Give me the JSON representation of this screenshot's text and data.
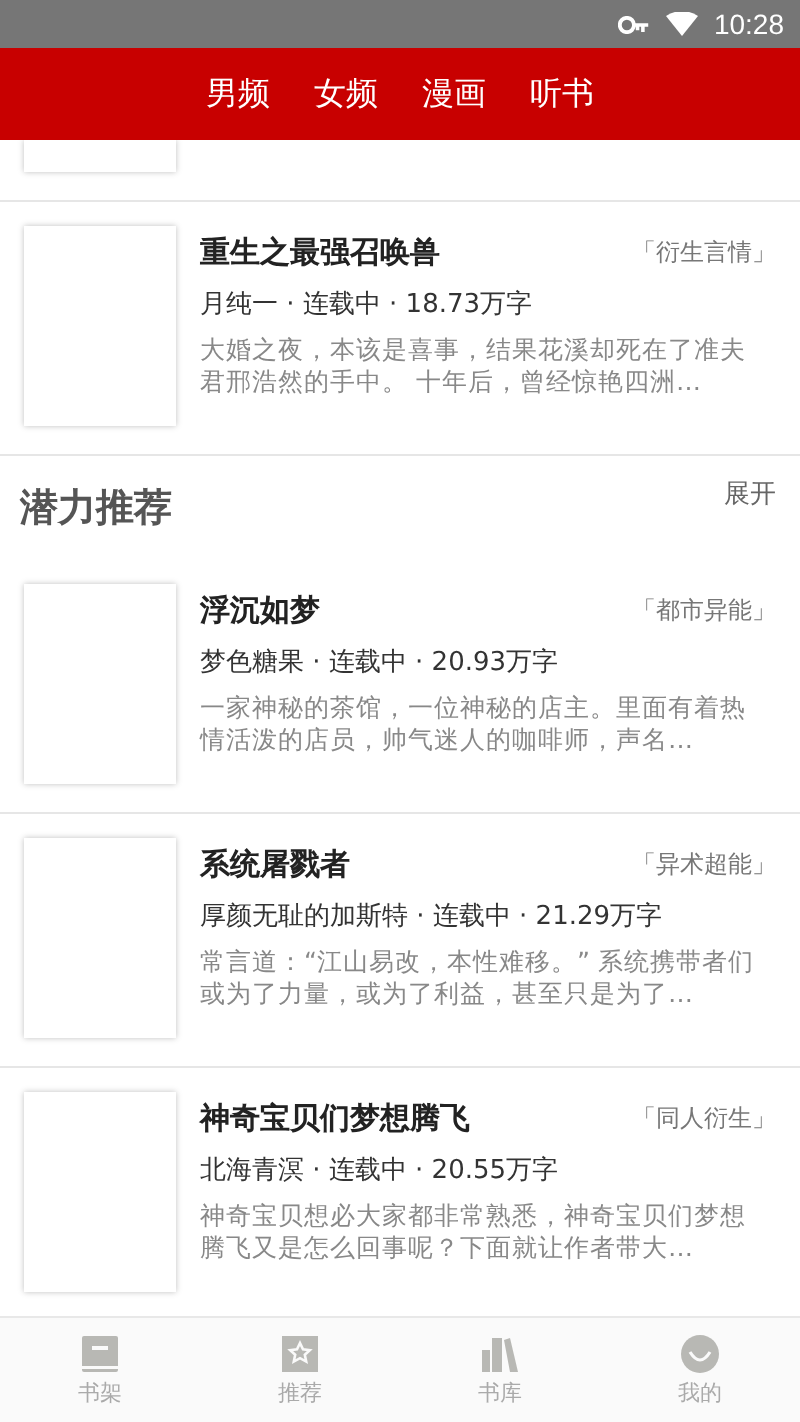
{
  "status_bar": {
    "time": "10:28"
  },
  "tabs": [
    {
      "label": "男频",
      "selected": false
    },
    {
      "label": "女频",
      "selected": false
    },
    {
      "label": "漫画",
      "selected": false
    },
    {
      "label": "听书",
      "selected": false
    }
  ],
  "top_books": [
    {
      "title": "重生之最强召唤兽",
      "tag": "「衍生言情」",
      "meta": "月纯一 · 连载中 · 18.73万字",
      "description": "大婚之夜，本该是喜事，结果花溪却死在了准夫君邢浩然的手中。 十年后，曾经惊艳四洲…"
    }
  ],
  "section": {
    "title": "潜力推荐",
    "action": "展开",
    "books": [
      {
        "title": "浮沉如梦",
        "tag": "「都市异能」",
        "meta": "梦色糖果 · 连载中 · 20.93万字",
        "description": "一家神秘的茶馆，一位神秘的店主。里面有着热情活泼的店员，帅气迷人的咖啡师，声名…"
      },
      {
        "title": "系统屠戮者",
        "tag": "「异术超能」",
        "meta": "厚颜无耻的加斯特 · 连载中 · 21.29万字",
        "description": "常言道：“江山易改，本性难移。” 系统携带者们或为了力量，或为了利益，甚至只是为了…"
      },
      {
        "title": "神奇宝贝们梦想腾飞",
        "tag": "「同人衍生」",
        "meta": "北海青溟 · 连载中 · 20.55万字",
        "description": "神奇宝贝想必大家都非常熟悉，神奇宝贝们梦想腾飞又是怎么回事呢？下面就让作者带大…"
      }
    ]
  },
  "bottom_nav": [
    {
      "label": "书架",
      "kind": "shelf",
      "selected": false
    },
    {
      "label": "推荐",
      "kind": "star",
      "selected": false
    },
    {
      "label": "书库",
      "kind": "library",
      "selected": false
    },
    {
      "label": "我的",
      "kind": "me",
      "selected": false
    }
  ]
}
